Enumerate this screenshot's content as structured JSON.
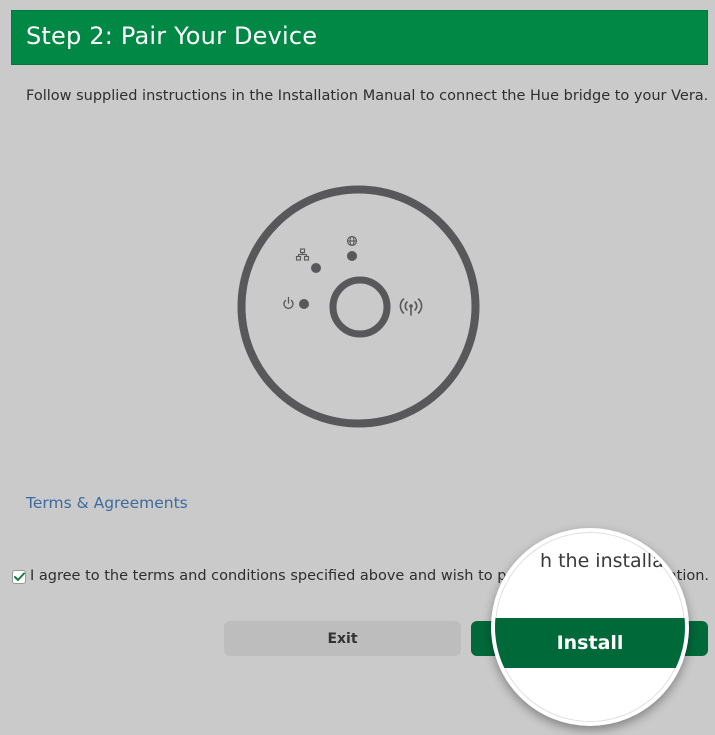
{
  "header": {
    "title": "Step 2: Pair Your Device"
  },
  "instructions": "Follow supplied instructions in the Installation Manual to connect the Hue bridge to your Vera.",
  "device": {
    "icons": [
      "network-icon",
      "globe-icon",
      "power-icon",
      "wireless-icon"
    ],
    "colors": {
      "ring": "#58585a",
      "led": "#58585a"
    }
  },
  "terms": {
    "link_label": "Terms & Agreements"
  },
  "agreement": {
    "checked": true,
    "label": "I agree to the terms and conditions specified above and wish to proceed with the installation."
  },
  "buttons": {
    "exit_label": "Exit",
    "install_label": "Install"
  },
  "magnifier": {
    "text": "h the installatio"
  },
  "colors": {
    "header": "#008844",
    "install": "#00693a",
    "link": "#3d6b9e",
    "background": "#cacaca"
  }
}
